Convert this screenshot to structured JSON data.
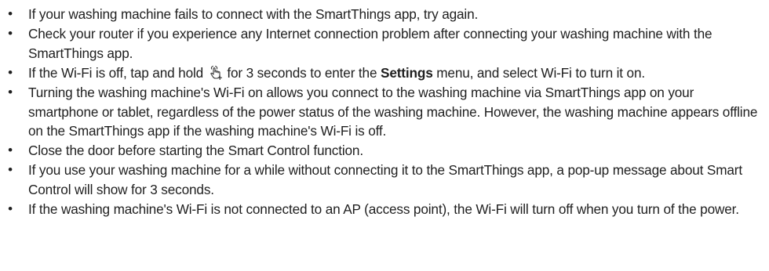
{
  "notes": [
    {
      "text": "If your washing machine fails to connect with the SmartThings app, try again."
    },
    {
      "text": "Check your router if you experience any Internet connection problem after connecting your washing machine with the SmartThings app."
    },
    {
      "text_before_icon": "If the Wi-Fi is off, tap and hold",
      "icon": "hand-touch-hold-icon",
      "text_after_icon": "for 3 seconds to enter the",
      "bold_term": "Settings",
      "text_end": "menu, and select Wi-Fi to turn it on."
    },
    {
      "text": "Turning the washing machine's Wi-Fi on allows you connect to the washing machine via SmartThings app on your smartphone or tablet, regardless of the power status of the washing machine. However, the washing machine appears offline on the SmartThings app if the washing machine's Wi-Fi is off."
    },
    {
      "text": "Close the door before starting the Smart Control function."
    },
    {
      "text": "If you use your washing machine for a while without connecting it to the SmartThings app, a pop-up message about Smart Control will show for 3 seconds."
    },
    {
      "text": "If the washing machine's Wi-Fi is not connected to an AP (access point), the Wi-Fi will turn off when you turn of the power."
    }
  ]
}
